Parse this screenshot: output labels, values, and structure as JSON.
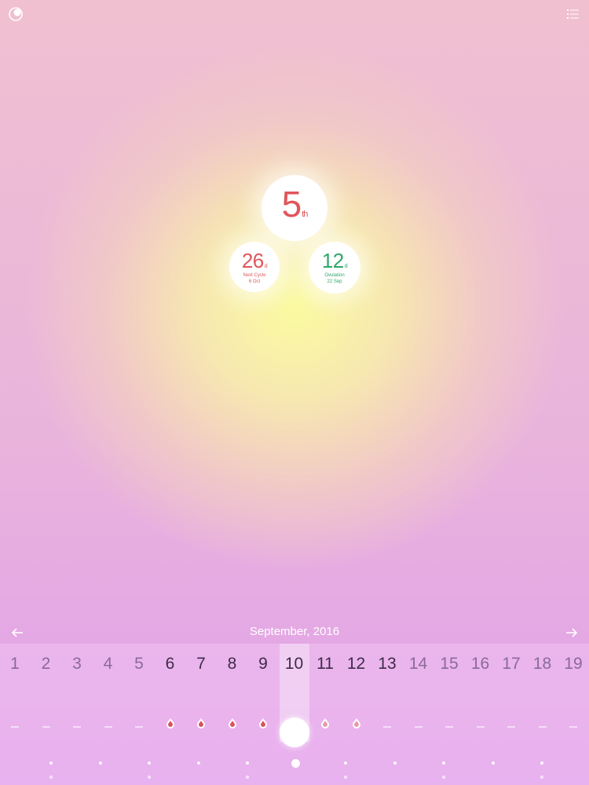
{
  "header": {
    "logo_icon": "moon-logo-icon",
    "menu_icon": "list-menu-icon"
  },
  "summary": {
    "cycle_day": {
      "value": "5",
      "suffix": "th"
    },
    "next_cycle": {
      "value": "26",
      "suffix": "d",
      "label": "Next Cycle",
      "date": "6 Oct"
    },
    "ovulation": {
      "value": "12",
      "suffix": "d",
      "label": "Ovulation",
      "date": "22 Sep"
    },
    "colors": {
      "period": "#e0565c",
      "ovulation": "#2fa76a"
    }
  },
  "calendar": {
    "month": "September, 2016",
    "prev_icon": "arrow-left-icon",
    "next_icon": "arrow-right-icon",
    "days": [
      "1",
      "2",
      "3",
      "4",
      "5",
      "6",
      "7",
      "8",
      "9",
      "10",
      "11",
      "12",
      "13",
      "14",
      "15",
      "16",
      "17",
      "18",
      "19"
    ],
    "selected_day": "10",
    "period_days": [
      "6",
      "7",
      "8",
      "9"
    ],
    "predicted_days": [
      "11",
      "12"
    ]
  }
}
